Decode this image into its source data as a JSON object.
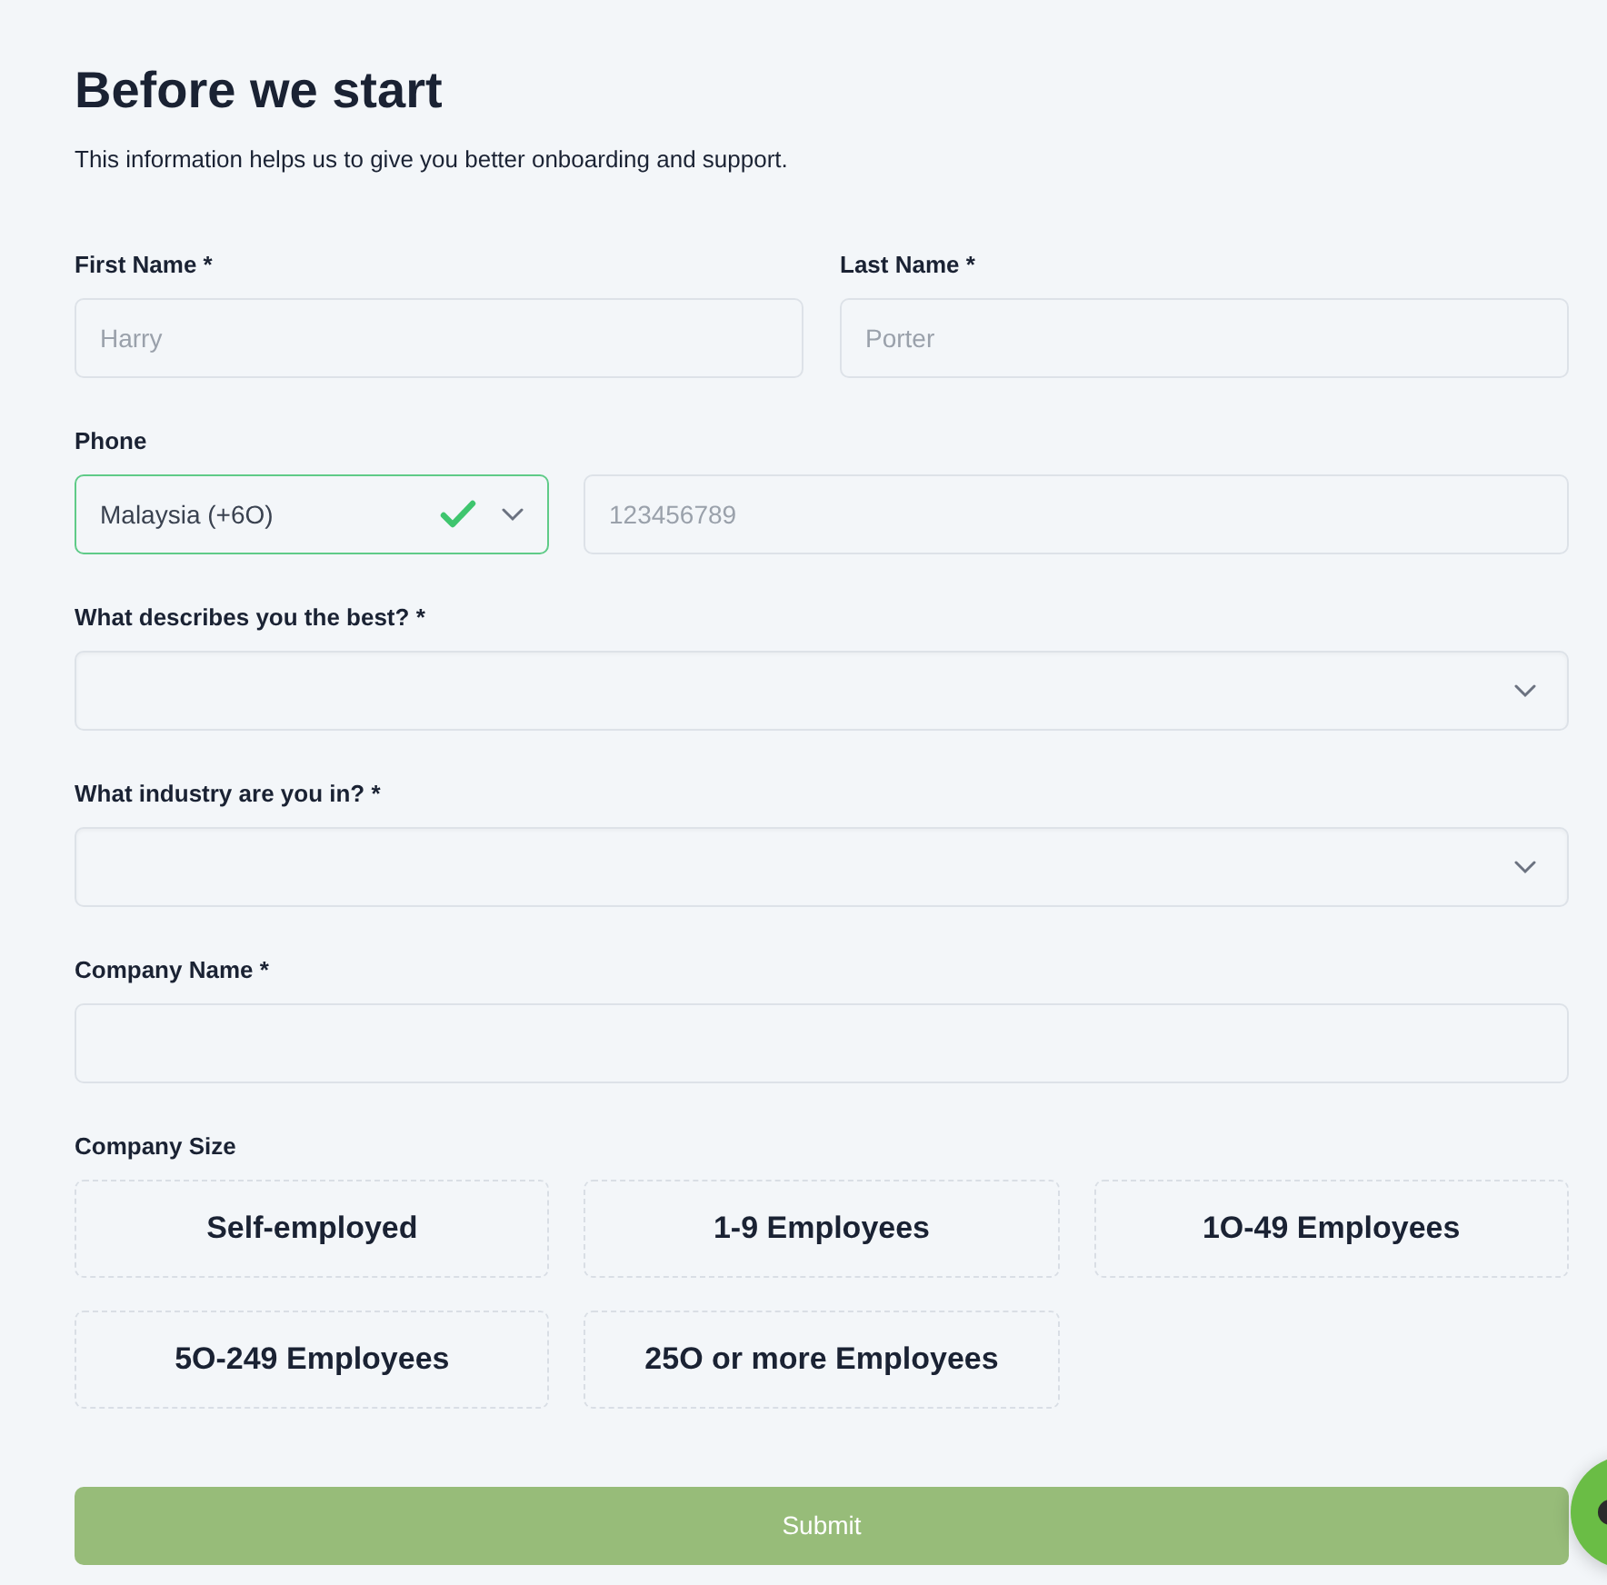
{
  "title": "Before we start",
  "subtitle": "This information helps us to give you better onboarding and support.",
  "first_name": {
    "label": "First Name *",
    "placeholder": "Harry"
  },
  "last_name": {
    "label": "Last Name *",
    "placeholder": "Porter"
  },
  "phone": {
    "label": "Phone",
    "country": "Malaysia (+6O)",
    "valid": true,
    "placeholder": "123456789"
  },
  "describes": {
    "label": "What describes you the best? *"
  },
  "industry": {
    "label": "What industry are you in? *"
  },
  "company_name": {
    "label": "Company Name *"
  },
  "company_size": {
    "label": "Company Size",
    "options": [
      {
        "label": "Self-employed",
        "selected": false
      },
      {
        "label": "1-9 Employees",
        "selected": false
      },
      {
        "label": "1O-49 Employees",
        "selected": false
      },
      {
        "label": "5O-249 Employees",
        "selected": false
      },
      {
        "label": "25O or more Employees",
        "selected": false
      }
    ]
  },
  "submit": {
    "label": "Submit",
    "disabled": true
  }
}
